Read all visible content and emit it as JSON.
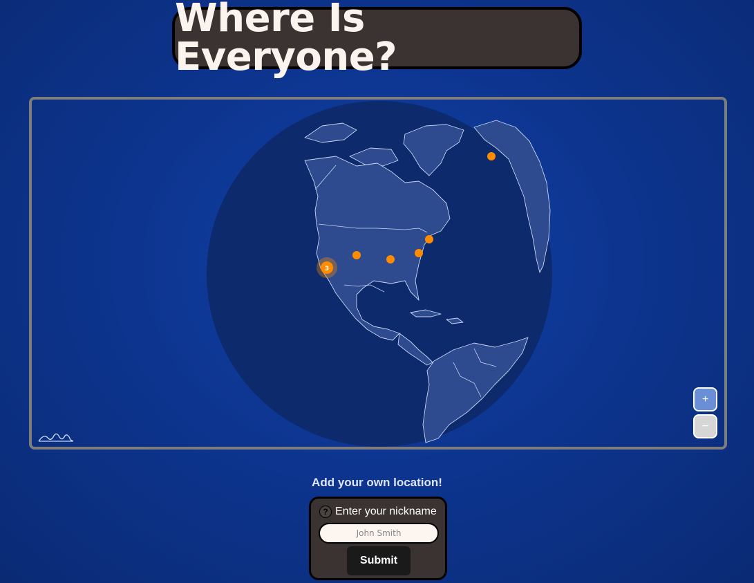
{
  "header": {
    "title": "Where Is Everyone?"
  },
  "map": {
    "zoom_in_label": "+",
    "zoom_out_label": "−",
    "cluster_count": "3",
    "marker_color": "#ff8c00",
    "land_color": "#2f4b8f",
    "ocean_color": "#0c2a6c"
  },
  "form": {
    "heading": "Add your own location!",
    "help_icon": "?",
    "nickname_label": "Enter your nickname",
    "nickname_placeholder": "John Smith",
    "nickname_value": "",
    "submit_label": "Submit"
  }
}
